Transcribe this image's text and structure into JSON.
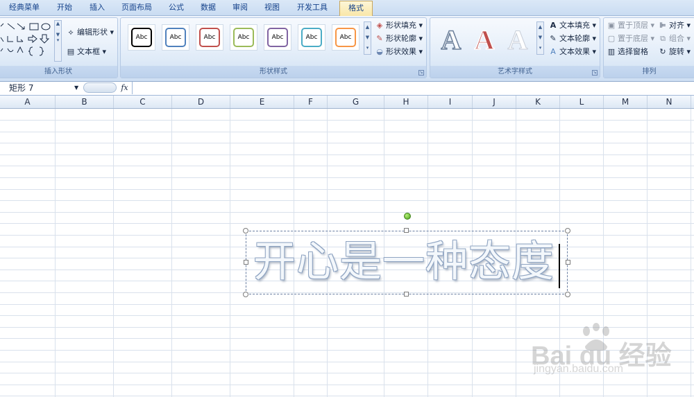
{
  "tabs": [
    {
      "label": "经典菜单"
    },
    {
      "label": "开始"
    },
    {
      "label": "插入"
    },
    {
      "label": "页面布局"
    },
    {
      "label": "公式"
    },
    {
      "label": "数据"
    },
    {
      "label": "审阅"
    },
    {
      "label": "视图"
    },
    {
      "label": "开发工具"
    },
    {
      "label": "格式"
    }
  ],
  "active_tab": "格式",
  "groups": {
    "insert_shapes": {
      "label": "插入形状",
      "edit_shape": "编辑形状",
      "text_box": "文本框"
    },
    "shape_styles": {
      "label": "形状样式",
      "samples": [
        {
          "text": "Abc",
          "color": "#000000"
        },
        {
          "text": "Abc",
          "color": "#4f81bd"
        },
        {
          "text": "Abc",
          "color": "#c0504d"
        },
        {
          "text": "Abc",
          "color": "#9bbb59"
        },
        {
          "text": "Abc",
          "color": "#8064a2"
        },
        {
          "text": "Abc",
          "color": "#4bacc6"
        },
        {
          "text": "Abc",
          "color": "#f79646"
        }
      ],
      "fill": "形状填充",
      "outline": "形状轮廓",
      "effects": "形状效果"
    },
    "wordart_styles": {
      "label": "艺术字样式",
      "samples": [
        {
          "text": "A"
        },
        {
          "text": "A"
        },
        {
          "text": "A"
        }
      ],
      "text_fill": "文本填充",
      "text_outline": "文本轮廓",
      "text_effects": "文本效果"
    },
    "arrange": {
      "label": "排列",
      "bring_front": "置于顶层",
      "send_back": "置于底层",
      "selection_pane": "选择窗格",
      "align": "对齐",
      "group": "组合",
      "rotate": "旋转"
    }
  },
  "formula_bar": {
    "name_box": "矩形 7",
    "fx": "fx",
    "content": ""
  },
  "columns": [
    "A",
    "B",
    "C",
    "D",
    "E",
    "F",
    "G",
    "H",
    "I",
    "J",
    "K",
    "L",
    "M",
    "N"
  ],
  "shape": {
    "text": "开心是一种态度"
  },
  "watermark": {
    "main": "Bai du 经验",
    "sub": "jingyan.baidu.com"
  },
  "colors": {
    "accent": "#15428b",
    "ribbon": "#dbe8f7",
    "grid": "#d9e1ec"
  }
}
